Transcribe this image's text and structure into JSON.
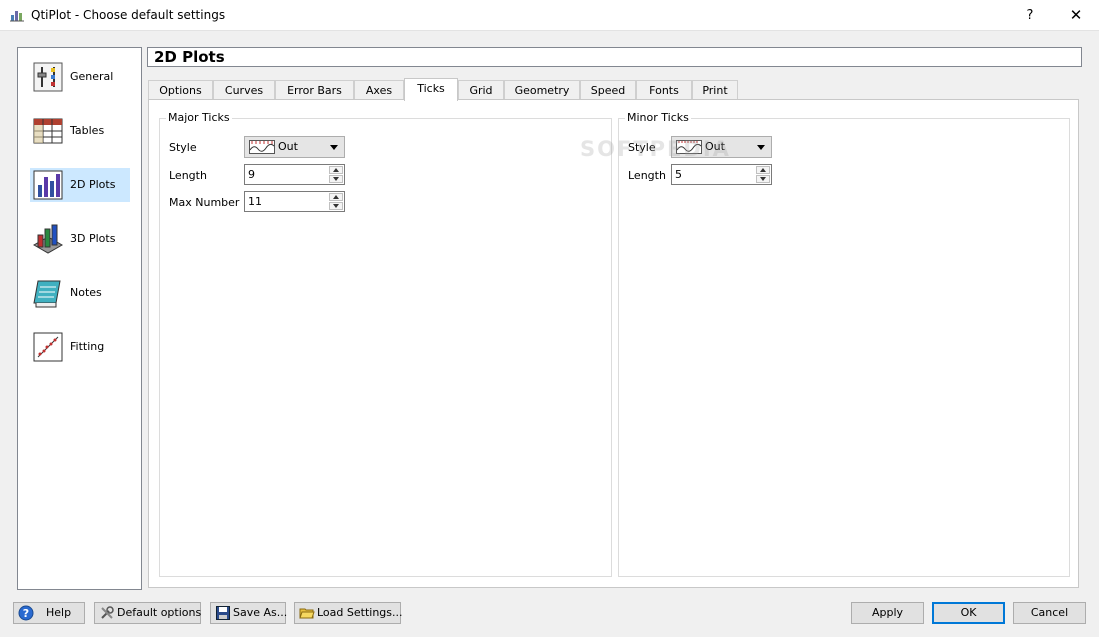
{
  "window": {
    "title": "QtiPlot - Choose default settings",
    "help_glyph": "?",
    "close_glyph": "✕"
  },
  "sidebar": {
    "items": [
      {
        "label": "General",
        "icon": "sliders-icon"
      },
      {
        "label": "Tables",
        "icon": "table-icon"
      },
      {
        "label": "2D Plots",
        "icon": "bar-chart-icon",
        "selected": true
      },
      {
        "label": "3D Plots",
        "icon": "3d-bar-chart-icon"
      },
      {
        "label": "Notes",
        "icon": "notes-icon"
      },
      {
        "label": "Fitting",
        "icon": "fitting-icon"
      }
    ]
  },
  "panel": {
    "title": "2D Plots",
    "tabs": [
      "Options",
      "Curves",
      "Error Bars",
      "Axes",
      "Ticks",
      "Grid",
      "Geometry",
      "Speed",
      "Fonts",
      "Print"
    ],
    "active_tab": "Ticks"
  },
  "major_ticks": {
    "group_title": "Major Ticks",
    "style_label": "Style",
    "style_value": "Out",
    "length_label": "Length",
    "length_value": "9",
    "max_number_label": "Max Number",
    "max_number_value": "11"
  },
  "minor_ticks": {
    "group_title": "Minor Ticks",
    "style_label": "Style",
    "style_value": "Out",
    "length_label": "Length",
    "length_value": "5"
  },
  "watermark": "SOFTPEDIA",
  "buttons": {
    "help": "Help",
    "default_options": "Default options",
    "save_as": "Save As...",
    "load_settings": "Load Settings...",
    "apply": "Apply",
    "ok": "OK",
    "cancel": "Cancel"
  },
  "colors": {
    "selection": "#cce8ff",
    "default_button_border": "#0078d7"
  }
}
